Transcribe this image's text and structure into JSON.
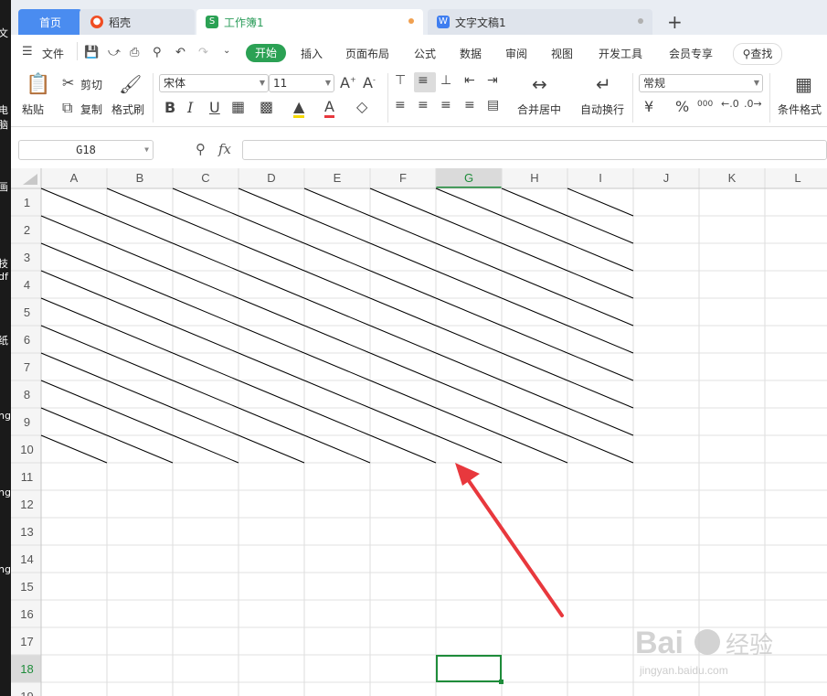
{
  "desktop_strip": [
    "文",
    "电脑",
    "画",
    "技",
    "df",
    "纸",
    "ng",
    "ng",
    "ng"
  ],
  "tabs": {
    "home": "首页",
    "daoke": "稻壳",
    "workbook": "工作簿1",
    "document": "文字文稿1",
    "new_tab": "+"
  },
  "menu": {
    "file": "文件",
    "start": "开始",
    "items": [
      "插入",
      "页面布局",
      "公式",
      "数据",
      "审阅",
      "视图",
      "开发工具",
      "会员专享"
    ],
    "search": "查找"
  },
  "ribbon": {
    "paste": "粘贴",
    "cut": "剪切",
    "copy": "复制",
    "format_painter": "格式刷",
    "font_name": "宋体",
    "font_size": "11",
    "merge_center": "合并居中",
    "wrap_text": "自动换行",
    "number_format": "常规",
    "conditional_format": "条件格式",
    "percent": "%",
    "thousands": "000",
    "bold": "B",
    "italic": "I",
    "underline": "U"
  },
  "formula_bar": {
    "name_box": "G18",
    "fx": "fx",
    "formula": ""
  },
  "sheet": {
    "columns": [
      "A",
      "B",
      "C",
      "D",
      "E",
      "F",
      "G",
      "H",
      "I",
      "J",
      "K",
      "L"
    ],
    "rows": [
      "1",
      "2",
      "3",
      "4",
      "5",
      "6",
      "7",
      "8",
      "9",
      "10",
      "11",
      "12",
      "13",
      "14",
      "15",
      "16",
      "17",
      "18",
      "19"
    ],
    "active_cell": "G18",
    "active_column": "G",
    "active_row": "18",
    "diagonal_borders": {
      "rows": [
        1,
        10
      ],
      "columns": [
        "A",
        "I"
      ]
    }
  },
  "watermark": {
    "brand": "Bai",
    "brand2": "经验",
    "url": "jingyan.baidu.com"
  },
  "colors": {
    "accent_green": "#2ba154",
    "tab_blue": "#4a8cf0",
    "arrow_red": "#e8383d",
    "active_cell": "#1e8c3a"
  }
}
